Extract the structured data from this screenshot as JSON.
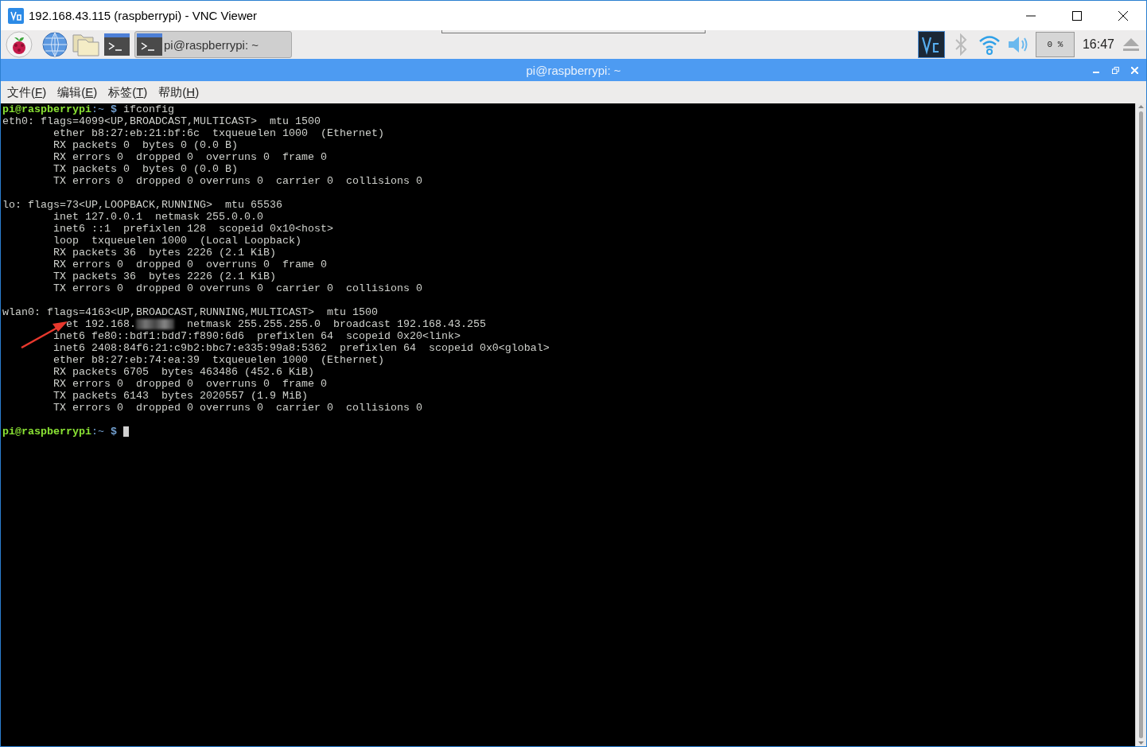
{
  "window": {
    "title": "192.168.43.115 (raspberrypi) - VNC Viewer"
  },
  "taskbar": {
    "task_button": {
      "label": "pi@raspberrypi: ~",
      "selected": true
    },
    "cpu_monitor": {
      "label": "0 %"
    },
    "clock": "16:47"
  },
  "terminal": {
    "title": "pi@raspberrypi: ~",
    "menu": [
      {
        "label": "文件(",
        "key": "F",
        "after": ")"
      },
      {
        "label": "编辑(",
        "key": "E",
        "after": ")"
      },
      {
        "label": "标签(",
        "key": "T",
        "after": ")"
      },
      {
        "label": "帮助(",
        "key": "H",
        "after": ")"
      }
    ],
    "output": [
      {
        "kind": "prompt",
        "user": "pi@raspberrypi",
        "path": ":~",
        "symbol": "$",
        "command": "ifconfig"
      },
      {
        "kind": "block",
        "header": "eth0: flags=4099<UP,BROADCAST,MULTICAST>  mtu 1500",
        "children": [
          {
            "kind": "text",
            "text": "ether b8:27:eb:21:bf:6c  txqueuelen 1000  (Ethernet)"
          },
          {
            "kind": "text",
            "text": "RX packets 0  bytes 0 (0.0 B)"
          },
          {
            "kind": "text",
            "text": "RX errors 0  dropped 0  overruns 0  frame 0"
          },
          {
            "kind": "text",
            "text": "TX packets 0  bytes 0 (0.0 B)"
          },
          {
            "kind": "text",
            "text": "TX errors 0  dropped 0 overruns 0  carrier 0  collisions 0"
          }
        ]
      },
      {
        "kind": "blank"
      },
      {
        "kind": "block",
        "header": "lo: flags=73<UP,LOOPBACK,RUNNING>  mtu 65536",
        "children": [
          {
            "kind": "text",
            "text": "inet 127.0.0.1  netmask 255.0.0.0"
          },
          {
            "kind": "text",
            "text": "inet6 ::1  prefixlen 128  scopeid 0x10<host>"
          },
          {
            "kind": "text",
            "text": "loop  txqueuelen 1000  (Local Loopback)"
          },
          {
            "kind": "text",
            "text": "RX packets 36  bytes 2226 (2.1 KiB)"
          },
          {
            "kind": "text",
            "text": "RX errors 0  dropped 0  overruns 0  frame 0"
          },
          {
            "kind": "text",
            "text": "TX packets 36  bytes 2226 (2.1 KiB)"
          },
          {
            "kind": "text",
            "text": "TX errors 0  dropped 0 overruns 0  carrier 0  collisions 0"
          }
        ]
      },
      {
        "kind": "blank"
      },
      {
        "kind": "block",
        "header": "wlan0: flags=4163<UP,BROADCAST,RUNNING,MULTICAST>  mtu 1500",
        "children": [
          {
            "kind": "redacted",
            "text": "et 192.168.",
            "after": "netmask 255.255.255.0  broadcast 192.168.43.255"
          },
          {
            "kind": "text",
            "text": "inet6 fe80::bdf1:bdd7:f890:6d6  prefixlen 64  scopeid 0x20<link>"
          },
          {
            "kind": "text",
            "text": "inet6 2408:84f6:21:c9b2:bbc7:e335:99a8:5362  prefixlen 64  scopeid 0x0<global>"
          },
          {
            "kind": "text",
            "text": "ether b8:27:eb:74:ea:39  txqueuelen 1000  (Ethernet)"
          },
          {
            "kind": "text",
            "text": "RX packets 6705  bytes 463486 (452.6 KiB)"
          },
          {
            "kind": "text",
            "text": "RX errors 0  dropped 0  overruns 0  frame 0"
          },
          {
            "kind": "text",
            "text": "TX packets 6143  bytes 2020557 (1.9 MiB)"
          },
          {
            "kind": "text",
            "text": "TX errors 0  dropped 0 overruns 0  carrier 0  collisions 0"
          }
        ]
      },
      {
        "kind": "blank"
      },
      {
        "kind": "prompt",
        "user": "pi@raspberrypi",
        "path": ":~",
        "symbol": "$",
        "cursor": true
      }
    ],
    "annotations": [
      {
        "kind": "arrow"
      }
    ]
  }
}
